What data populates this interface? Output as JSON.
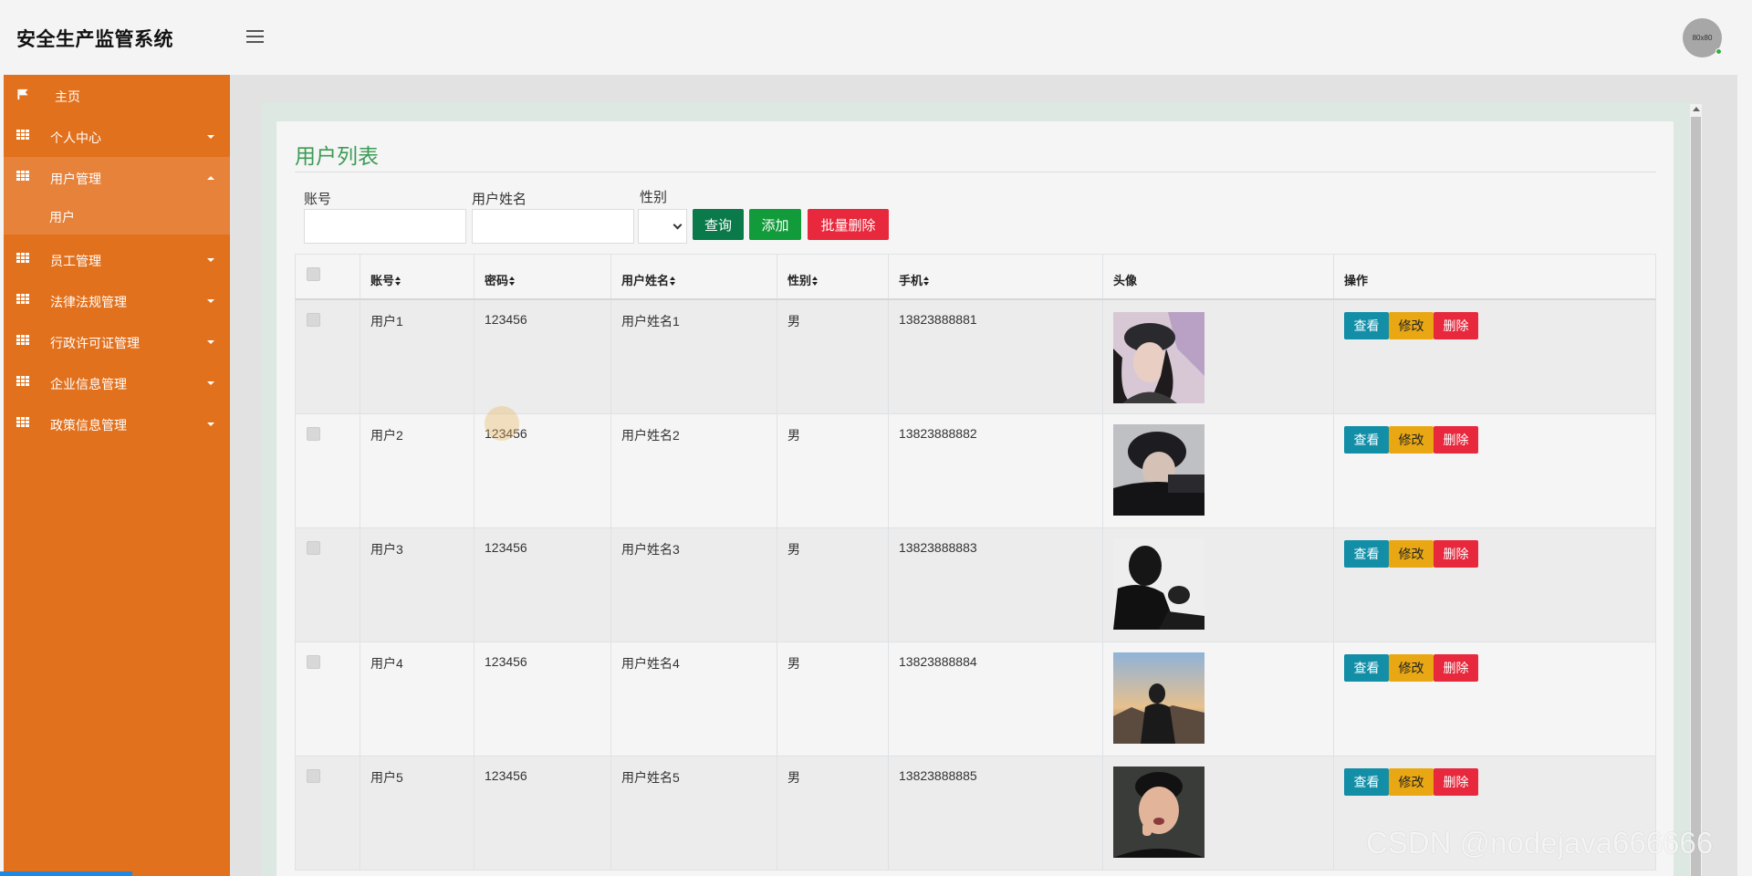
{
  "app": {
    "title": "安全生产监管系统",
    "avatar_text": "80x80"
  },
  "sidebar": {
    "items": [
      {
        "label": "主页",
        "icon": "flag-icon",
        "expandable": false
      },
      {
        "label": "个人中心",
        "icon": "grid-icon",
        "expandable": true
      },
      {
        "label": "用户管理",
        "icon": "grid-icon",
        "expandable": true,
        "open": true,
        "children": [
          {
            "label": "用户"
          }
        ]
      },
      {
        "label": "员工管理",
        "icon": "grid-icon",
        "expandable": true
      },
      {
        "label": "法律法规管理",
        "icon": "grid-icon",
        "expandable": true
      },
      {
        "label": "行政许可证管理",
        "icon": "grid-icon",
        "expandable": true
      },
      {
        "label": "企业信息管理",
        "icon": "grid-icon",
        "expandable": true
      },
      {
        "label": "政策信息管理",
        "icon": "grid-icon",
        "expandable": true
      }
    ]
  },
  "main": {
    "title": "用户列表",
    "filters": {
      "account_label": "账号",
      "account_value": "",
      "name_label": "用户姓名",
      "name_value": "",
      "gender_label": "性别",
      "gender_value": ""
    },
    "buttons": {
      "query": "查询",
      "add": "添加",
      "batch_delete": "批量删除"
    },
    "table": {
      "columns": [
        "账号",
        "密码",
        "用户姓名",
        "性别",
        "手机",
        "头像",
        "操作"
      ],
      "rows": [
        {
          "account": "用户1",
          "password": "123456",
          "name": "用户姓名1",
          "gender": "男",
          "phone": "13823888881"
        },
        {
          "account": "用户2",
          "password": "123456",
          "name": "用户姓名2",
          "gender": "男",
          "phone": "13823888882"
        },
        {
          "account": "用户3",
          "password": "123456",
          "name": "用户姓名3",
          "gender": "男",
          "phone": "13823888883"
        },
        {
          "account": "用户4",
          "password": "123456",
          "name": "用户姓名4",
          "gender": "男",
          "phone": "13823888884"
        },
        {
          "account": "用户5",
          "password": "123456",
          "name": "用户姓名5",
          "gender": "男",
          "phone": "13823888885"
        }
      ],
      "actions": {
        "view": "查看",
        "edit": "修改",
        "delete": "删除"
      }
    }
  },
  "watermark": "CSDN @nodejava666666",
  "colors": {
    "sidebar": "#e2711d",
    "sidebar_active": "#e7823a",
    "title_green": "#3c9b55",
    "query_btn": "#0b7a4b",
    "add_btn": "#129b3a",
    "delete_btn": "#e8283c",
    "view_btn": "#138ea7",
    "edit_btn": "#e9a813"
  }
}
